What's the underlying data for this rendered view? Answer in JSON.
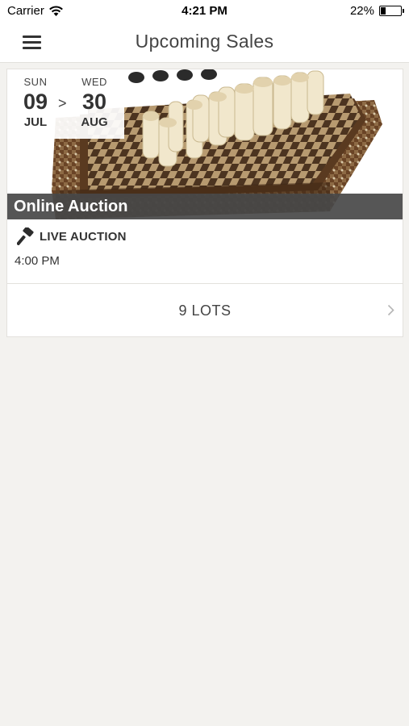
{
  "status_bar": {
    "carrier": "Carrier",
    "time": "4:21 PM",
    "battery_text": "22%",
    "battery_level": 0.22
  },
  "nav": {
    "title": "Upcoming Sales",
    "menu_icon": "hamburger-menu-icon"
  },
  "sales": [
    {
      "start": {
        "dow": "SUN",
        "day": "09",
        "month": "JUL"
      },
      "separator": ">",
      "end": {
        "dow": "WED",
        "day": "30",
        "month": "AUG"
      },
      "name": "Online Auction",
      "type_icon": "gavel-icon",
      "type": "LIVE AUCTION",
      "time": "4:00 PM",
      "lots": "9 LOTS"
    }
  ],
  "colors": {
    "background": "#f3f2ef",
    "card": "#ffffff",
    "name_band": "#484848",
    "text": "#333333"
  }
}
